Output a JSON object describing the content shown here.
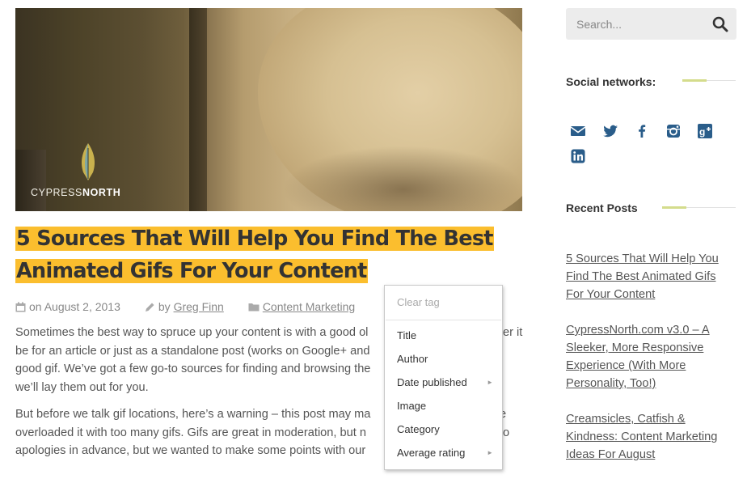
{
  "hero": {
    "logo_text_light": "CYPRESS",
    "logo_text_bold": "NORTH"
  },
  "post": {
    "title": "5 Sources That Will Help You Find The Best Animated Gifs For Your Content",
    "date": "on August 2, 2013",
    "by": "by",
    "author": "Greg Finn",
    "category": "Content Marketing",
    "paragraphs": [
      "Sometimes the best way to spruce up your content is with a good ol",
      "be for an article or just as a standalone post (works on Google+ and",
      "good gif. We’ve got a few go-to sources for finding and browsing the",
      "we’ll lay them out for you.",
      "But before we talk gif locations, here’s a warning – this post may ma",
      "overloaded it with too many gifs. Gifs are great in moderation, but n",
      "apologies in advance, but we wanted to make some points with our"
    ],
    "para_tails": [
      "er it",
      "",
      "",
      "",
      "e",
      "o",
      ""
    ]
  },
  "context_menu": {
    "clear_tag": "Clear tag",
    "items": [
      "Title",
      "Author",
      "Date published",
      "Image",
      "Category",
      "Average rating"
    ],
    "submenu_arrow": "►"
  },
  "sidebar": {
    "search_placeholder": "Search...",
    "social_title": "Social networks:",
    "social_icons": [
      "email-icon",
      "twitter-icon",
      "facebook-icon",
      "instagram-icon",
      "google-plus-icon",
      "linkedin-icon"
    ],
    "recent_title": "Recent Posts",
    "recent_posts": [
      "5 Sources That Will Help You Find The Best Animated Gifs For Your Content",
      "CypressNorth.com v3.0 – A Sleeker, More Responsive Experience (With More Personality, Too!)",
      "Creamsicles, Catfish & Kindness: Content Marketing Ideas For August"
    ]
  },
  "colors": {
    "highlight": "#fbbe2e",
    "accent_line": "#d4dc8c",
    "icon_blue": "#2a5d8a"
  }
}
